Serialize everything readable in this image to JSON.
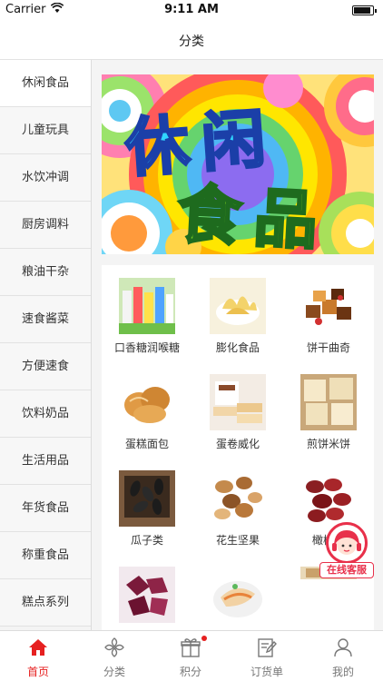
{
  "status_bar": {
    "carrier": "Carrier",
    "time": "9:11 AM"
  },
  "nav": {
    "title": "分类"
  },
  "sidebar": {
    "items": [
      {
        "label": "休闲食品"
      },
      {
        "label": "儿童玩具"
      },
      {
        "label": "水饮冲调"
      },
      {
        "label": "厨房调料"
      },
      {
        "label": "粮油干杂"
      },
      {
        "label": "速食酱菜"
      },
      {
        "label": "方便速食"
      },
      {
        "label": "饮料奶品"
      },
      {
        "label": "生活用品"
      },
      {
        "label": "年货食品"
      },
      {
        "label": "称重食品"
      },
      {
        "label": "糕点系列"
      }
    ],
    "active_index": 0
  },
  "banner": {
    "line1": "休闲",
    "line2": "食品"
  },
  "grid": {
    "items": [
      {
        "label": "口香糖润喉糖"
      },
      {
        "label": "膨化食品"
      },
      {
        "label": "饼干曲奇"
      },
      {
        "label": "蛋糕面包"
      },
      {
        "label": "蛋卷威化"
      },
      {
        "label": "煎饼米饼"
      },
      {
        "label": "瓜子类"
      },
      {
        "label": "花生坚果"
      },
      {
        "label": "橄榄红"
      },
      {
        "label": ""
      },
      {
        "label": ""
      },
      {
        "label": ""
      }
    ]
  },
  "service": {
    "label": "在线客服"
  },
  "tabs": [
    {
      "label": "首页",
      "active": true
    },
    {
      "label": "分类",
      "active": false
    },
    {
      "label": "积分",
      "active": false,
      "badge": true
    },
    {
      "label": "订货单",
      "active": false
    },
    {
      "label": "我的",
      "active": false
    }
  ],
  "colors": {
    "accent": "#e62020",
    "service": "#e8304a"
  }
}
